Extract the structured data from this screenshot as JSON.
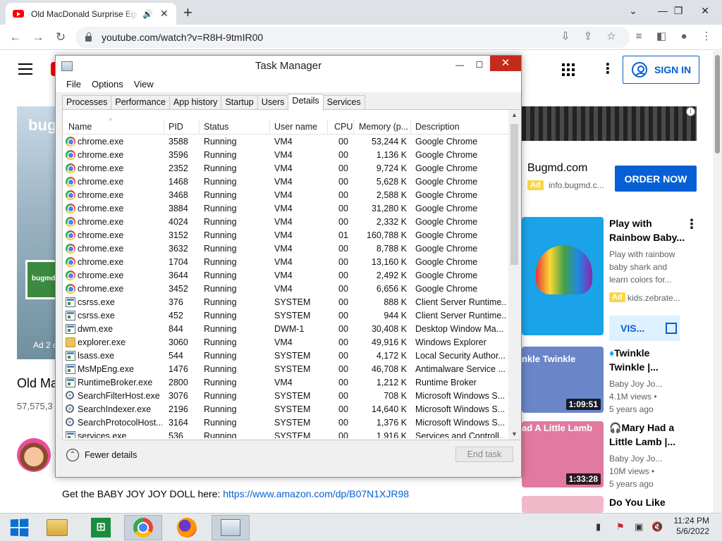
{
  "browser": {
    "tab_title": "Old MacDonald Surprise Eggs",
    "tab_audio_icon": "speaker-icon",
    "url": "youtube.com/watch?v=R8H-9tmIR00"
  },
  "youtube": {
    "signin_label": "SIGN IN",
    "video_overlay_brand": "bug",
    "video_tile_text": "bugmd",
    "ad_label": "Ad 2 c",
    "video_title": "Old Ma",
    "views": "57,575,3",
    "description_prefix": "Get the BABY JOY JOY DOLL here: ",
    "description_link": "https://www.amazon.com/dp/B07N1XJR98",
    "ad": {
      "advertiser": "Bugmd.com",
      "badge": "Ad",
      "url": "info.bugmd.c...",
      "cta": "ORDER NOW"
    },
    "recommendations": [
      {
        "title": "Play with Rainbow Baby...",
        "meta1": "Play with rainbow",
        "meta2": "baby shark and",
        "meta3": "learn colors for...",
        "badge": "Ad",
        "channel": "kids.zebrate...",
        "cta": "VIS..."
      },
      {
        "title": "Twinkle Twinkle |...",
        "channel": "Baby Joy Jo...",
        "views": "4.1M views •",
        "age": "5 years ago",
        "duration": "1:09:51",
        "thumb_caption": "nkle Twinkle"
      },
      {
        "title": "Mary Had a Little Lamb |...",
        "channel": "Baby Joy Jo...",
        "views": "10M views •",
        "age": "5 years ago",
        "duration": "1:33:28",
        "thumb_caption": "ad A Little Lamb"
      },
      {
        "title": "Do You Like"
      }
    ]
  },
  "taskmanager": {
    "title": "Task Manager",
    "menu": [
      "File",
      "Options",
      "View"
    ],
    "tabs": [
      "Processes",
      "Performance",
      "App history",
      "Startup",
      "Users",
      "Details",
      "Services"
    ],
    "active_tab": "Details",
    "columns": [
      "Name",
      "PID",
      "Status",
      "User name",
      "CPU",
      "Memory (p...",
      "Description"
    ],
    "rows": [
      [
        "chrome.exe",
        "3588",
        "Running",
        "VM4",
        "00",
        "53,244 K",
        "Google Chrome",
        "chrome"
      ],
      [
        "chrome.exe",
        "3596",
        "Running",
        "VM4",
        "00",
        "1,136 K",
        "Google Chrome",
        "chrome"
      ],
      [
        "chrome.exe",
        "2352",
        "Running",
        "VM4",
        "00",
        "9,724 K",
        "Google Chrome",
        "chrome"
      ],
      [
        "chrome.exe",
        "1468",
        "Running",
        "VM4",
        "00",
        "5,628 K",
        "Google Chrome",
        "chrome"
      ],
      [
        "chrome.exe",
        "3468",
        "Running",
        "VM4",
        "00",
        "2,588 K",
        "Google Chrome",
        "chrome"
      ],
      [
        "chrome.exe",
        "3884",
        "Running",
        "VM4",
        "00",
        "31,280 K",
        "Google Chrome",
        "chrome"
      ],
      [
        "chrome.exe",
        "4024",
        "Running",
        "VM4",
        "00",
        "2,332 K",
        "Google Chrome",
        "chrome"
      ],
      [
        "chrome.exe",
        "3152",
        "Running",
        "VM4",
        "01",
        "160,788 K",
        "Google Chrome",
        "chrome"
      ],
      [
        "chrome.exe",
        "3632",
        "Running",
        "VM4",
        "00",
        "8,788 K",
        "Google Chrome",
        "chrome"
      ],
      [
        "chrome.exe",
        "1704",
        "Running",
        "VM4",
        "00",
        "13,160 K",
        "Google Chrome",
        "chrome"
      ],
      [
        "chrome.exe",
        "3644",
        "Running",
        "VM4",
        "00",
        "2,492 K",
        "Google Chrome",
        "chrome"
      ],
      [
        "chrome.exe",
        "3452",
        "Running",
        "VM4",
        "00",
        "6,656 K",
        "Google Chrome",
        "chrome"
      ],
      [
        "csrss.exe",
        "376",
        "Running",
        "SYSTEM",
        "00",
        "888 K",
        "Client Server Runtime...",
        "sys"
      ],
      [
        "csrss.exe",
        "452",
        "Running",
        "SYSTEM",
        "00",
        "944 K",
        "Client Server Runtime...",
        "sys"
      ],
      [
        "dwm.exe",
        "844",
        "Running",
        "DWM-1",
        "00",
        "30,408 K",
        "Desktop Window Ma...",
        "sys"
      ],
      [
        "explorer.exe",
        "3060",
        "Running",
        "VM4",
        "00",
        "49,916 K",
        "Windows Explorer",
        "folder"
      ],
      [
        "lsass.exe",
        "544",
        "Running",
        "SYSTEM",
        "00",
        "4,172 K",
        "Local Security Author...",
        "sys"
      ],
      [
        "MsMpEng.exe",
        "1476",
        "Running",
        "SYSTEM",
        "00",
        "46,708 K",
        "Antimalware Service ...",
        "sys"
      ],
      [
        "RuntimeBroker.exe",
        "2800",
        "Running",
        "VM4",
        "00",
        "1,212 K",
        "Runtime Broker",
        "sys"
      ],
      [
        "SearchFilterHost.exe",
        "3076",
        "Running",
        "SYSTEM",
        "00",
        "708 K",
        "Microsoft Windows S...",
        "search"
      ],
      [
        "SearchIndexer.exe",
        "2196",
        "Running",
        "SYSTEM",
        "00",
        "14,640 K",
        "Microsoft Windows S...",
        "search"
      ],
      [
        "SearchProtocolHost....",
        "3164",
        "Running",
        "SYSTEM",
        "00",
        "1,376 K",
        "Microsoft Windows S...",
        "search"
      ],
      [
        "services.exe",
        "536",
        "Running",
        "SYSTEM",
        "00",
        "1,916 K",
        "Services and Controll...",
        "sys"
      ]
    ],
    "fewer_details": "Fewer details",
    "end_task": "End task"
  },
  "taskbar": {
    "apps": [
      "windows-start",
      "file-explorer",
      "store",
      "chrome",
      "firefox",
      "task-manager"
    ],
    "time": "11:24 PM",
    "date": "5/6/2022"
  }
}
